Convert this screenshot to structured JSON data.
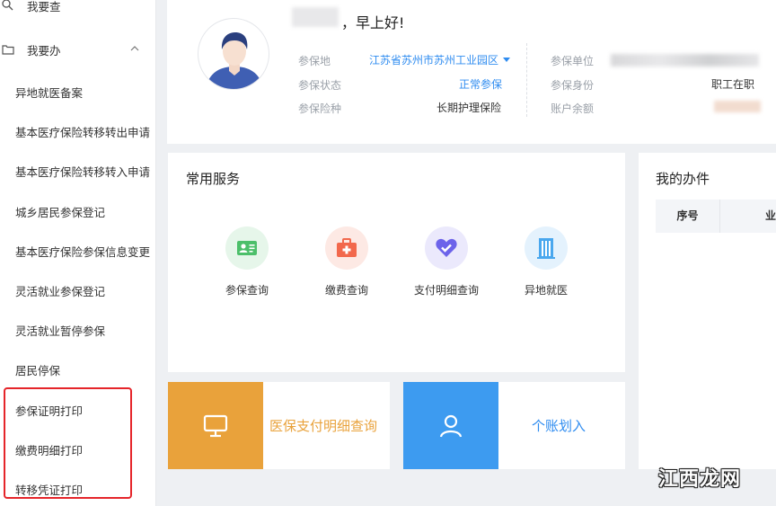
{
  "sidebar": {
    "top_item_label": "我要查",
    "group_label": "我要办",
    "items": [
      {
        "label": "异地就医备案"
      },
      {
        "label": "基本医疗保险转移转出申请"
      },
      {
        "label": "基本医疗保险转移转入申请"
      },
      {
        "label": "城乡居民参保登记"
      },
      {
        "label": "基本医疗保险参保信息变更"
      },
      {
        "label": "灵活就业参保登记"
      },
      {
        "label": "灵活就业暂停参保"
      },
      {
        "label": "居民停保"
      },
      {
        "label": "参保证明打印"
      },
      {
        "label": "缴费明细打印"
      },
      {
        "label": "转移凭证打印"
      }
    ]
  },
  "profile": {
    "greeting": "，早上好!",
    "fields": {
      "insured_place_label": "参保地",
      "insured_place_value": "江苏省苏州市苏州工业园区",
      "insured_status_label": "参保状态",
      "insured_status_value": "正常参保",
      "insurance_type_label": "参保险种",
      "insurance_type_value": "长期护理保险",
      "insured_unit_label": "参保单位",
      "insured_identity_label": "参保身份",
      "insured_identity_value": "职工在职",
      "account_balance_label": "账户余额"
    }
  },
  "services": {
    "title": "常用服务",
    "items": [
      {
        "label": "参保查询",
        "icon": "id-card-icon",
        "color": "#4cbf6a",
        "bg": "#e6f6ea"
      },
      {
        "label": "缴费查询",
        "icon": "medical-kit-icon",
        "color": "#f2684c",
        "bg": "#fde9e4"
      },
      {
        "label": "支付明细查询",
        "icon": "heart-check-icon",
        "color": "#6c63ea",
        "bg": "#ebe9fc"
      },
      {
        "label": "异地就医",
        "icon": "building-icon",
        "color": "#49a7ee",
        "bg": "#e4f2fd"
      }
    ]
  },
  "tasks": {
    "title": "我的办件",
    "columns": [
      "序号",
      "业"
    ]
  },
  "tiles": [
    {
      "label": "医保支付明细查询",
      "icon": "monitor-icon",
      "color": "#e9a23b"
    },
    {
      "label": "个账划入",
      "icon": "user-icon",
      "color": "#3d9bf0"
    }
  ],
  "watermark": "江西龙网",
  "colors": {
    "accent_blue": "#2f8cf0",
    "highlight_red": "#e5252a",
    "orange": "#e9a23b"
  }
}
